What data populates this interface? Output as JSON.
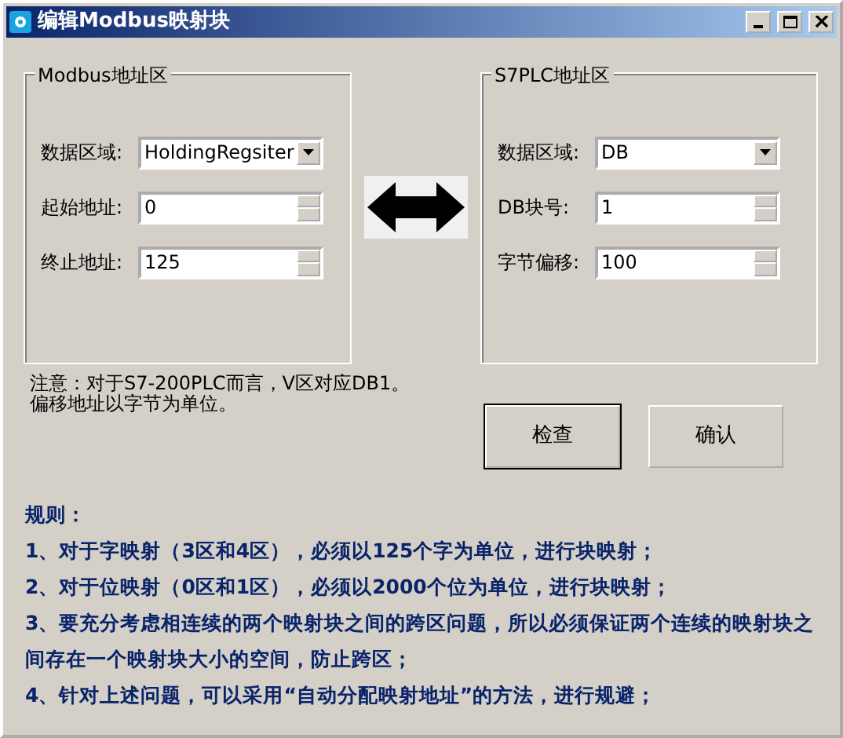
{
  "window": {
    "title": "编辑Modbus映射块"
  },
  "groups": [
    {
      "title": "Modbus地址区",
      "fields": [
        {
          "label": "数据区域:",
          "kind": "select",
          "value": "HoldingRegsiter"
        },
        {
          "label": "起始地址:",
          "kind": "spin",
          "value": "0"
        },
        {
          "label": "终止地址:",
          "kind": "spin",
          "value": "125"
        }
      ]
    },
    {
      "title": "S7PLC地址区",
      "fields": [
        {
          "label": "数据区域:",
          "kind": "select",
          "value": "DB"
        },
        {
          "label": "DB块号:",
          "kind": "spin",
          "value": "1"
        },
        {
          "label": "字节偏移:",
          "kind": "spin",
          "value": "100"
        }
      ]
    }
  ],
  "note": [
    "注意：对于S7-200PLC而言，V区对应DB1。",
    "偏移地址以字节为单位。"
  ],
  "buttons": [
    {
      "label": "检查",
      "default": true
    },
    {
      "label": "确认",
      "default": false
    }
  ],
  "rules": {
    "title": "规则：",
    "items": [
      "1、对于字映射（3区和4区），必须以125个字为单位，进行块映射；",
      "2、对于位映射（0区和1区），必须以2000个位为单位，进行块映射；",
      "3、要充分考虑相连续的两个映射块之间的跨区问题，所以必须保证两个连续的映射块之间存在一个映射块大小的空间，防止跨区；",
      "4、针对上述问题，可以采用“自动分配映射地址”的方法，进行规避；"
    ]
  }
}
